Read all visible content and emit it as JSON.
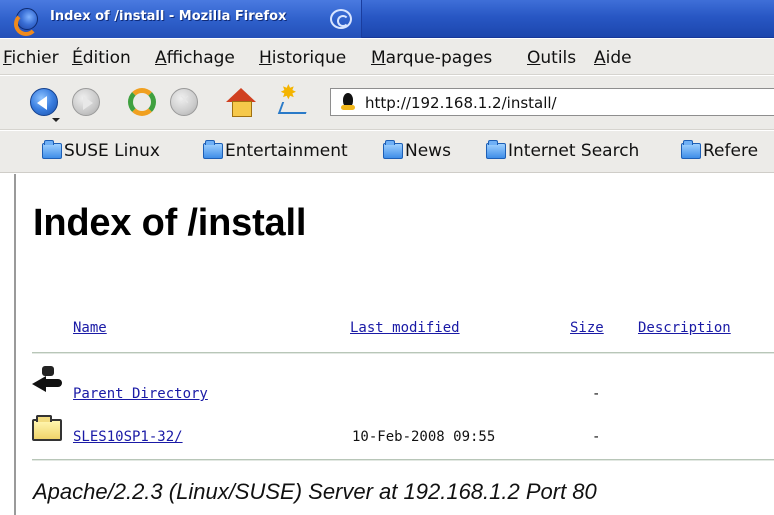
{
  "window": {
    "title": "Index of /install - Mozilla Firefox"
  },
  "menubar": {
    "items": [
      "Fichier",
      "Édition",
      "Affichage",
      "Historique",
      "Marque-pages",
      "Outils",
      "Aide"
    ]
  },
  "navigation": {
    "url": "http://192.168.1.2/install/"
  },
  "bookmarks": {
    "items": [
      "SUSE Linux",
      "Entertainment",
      "News",
      "Internet Search",
      "Refere"
    ]
  },
  "page": {
    "title": "Index of /install",
    "columns": {
      "name": "Name",
      "last_modified": "Last modified",
      "size": "Size",
      "description": "Description"
    },
    "rows": [
      {
        "name": "Parent Directory",
        "modified": "",
        "size": "-"
      },
      {
        "name": "SLES10SP1-32/",
        "modified": "10-Feb-2008 09:55",
        "size": "-"
      }
    ],
    "footer": "Apache/2.2.3 (Linux/SUSE) Server at 192.168.1.2 Port 80"
  }
}
